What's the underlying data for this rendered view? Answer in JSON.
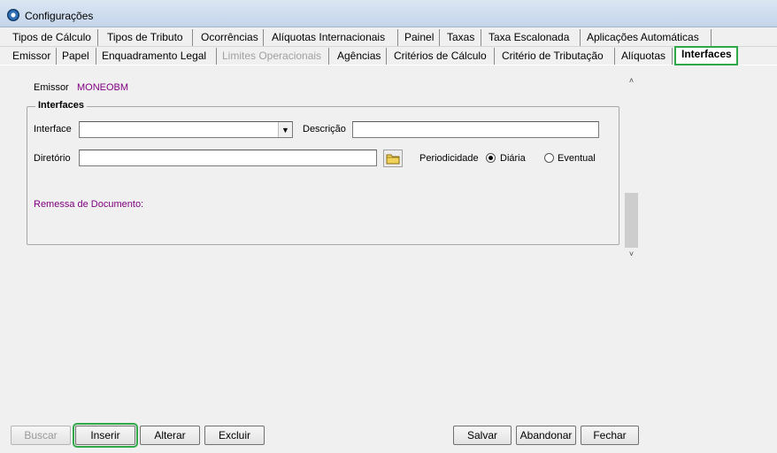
{
  "window": {
    "title": "Configurações"
  },
  "tabs_row1": [
    {
      "label": "Tipos de Cálculo"
    },
    {
      "label": "Tipos de Tributo"
    },
    {
      "label": "Ocorrências"
    },
    {
      "label": "Alíquotas Internacionais"
    },
    {
      "label": "Painel"
    },
    {
      "label": "Taxas"
    },
    {
      "label": "Taxa Escalonada"
    },
    {
      "label": "Aplicações Automáticas"
    }
  ],
  "tabs_row2": [
    {
      "label": "Emissor"
    },
    {
      "label": "Papel"
    },
    {
      "label": "Enquadramento Legal"
    },
    {
      "label": "Limites Operacionais",
      "disabled": true
    },
    {
      "label": "Agências"
    },
    {
      "label": "Critérios de Cálculo"
    },
    {
      "label": "Critério de Tributação"
    },
    {
      "label": "Alíquotas"
    },
    {
      "label": "Interfaces",
      "active": true
    }
  ],
  "emissor": {
    "label": "Emissor",
    "value": "MONEOBM"
  },
  "interfaces_group": {
    "title": "Interfaces",
    "interface_label": "Interface",
    "interface_value": "",
    "descricao_label": "Descrição",
    "descricao_value": "",
    "diretorio_label": "Diretório",
    "diretorio_value": "",
    "periodicidade_label": "Periodicidade",
    "options": [
      {
        "label": "Diária",
        "checked": true
      },
      {
        "label": "Eventual",
        "checked": false
      }
    ],
    "remessa_label": "Remessa de Documento:"
  },
  "buttons": {
    "buscar": "Buscar",
    "inserir": "Inserir",
    "alterar": "Alterar",
    "excluir": "Excluir",
    "salvar": "Salvar",
    "abandonar": "Abandonar",
    "fechar": "Fechar"
  },
  "colors": {
    "accent_highlight": "#2fa84a",
    "value_text": "#800080"
  },
  "icons": {
    "folder": "folder-icon",
    "app": "app-icon"
  }
}
